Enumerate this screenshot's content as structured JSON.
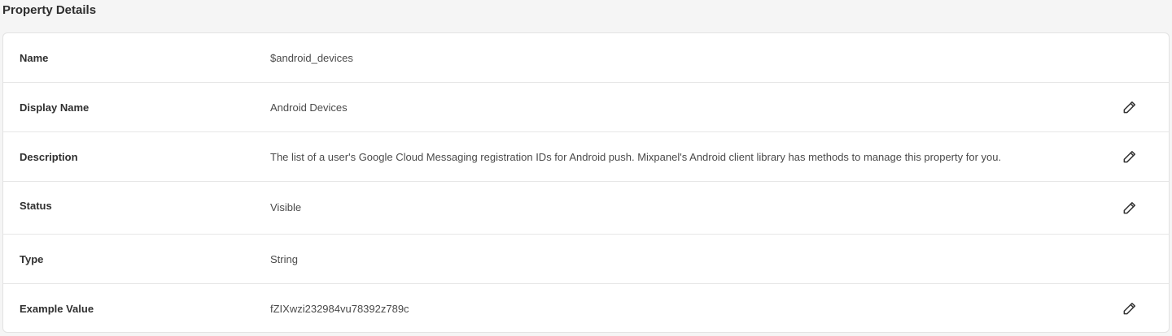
{
  "section": {
    "title": "Property Details"
  },
  "rows": [
    {
      "label": "Name",
      "value": "$android_devices",
      "editable": false
    },
    {
      "label": "Display Name",
      "value": "Android Devices",
      "editable": true
    },
    {
      "label": "Description",
      "value": "The list of a user's Google Cloud Messaging registration IDs for Android push. Mixpanel's Android client library has methods to manage this property for you.",
      "editable": true
    },
    {
      "label": "Status",
      "value": "Visible",
      "editable": true
    },
    {
      "label": "Type",
      "value": "String",
      "editable": false
    },
    {
      "label": "Example Value",
      "value": "fZIXwzi232984vu78392z789c",
      "editable": true
    }
  ],
  "icons": {
    "edit": "pencil-icon"
  }
}
